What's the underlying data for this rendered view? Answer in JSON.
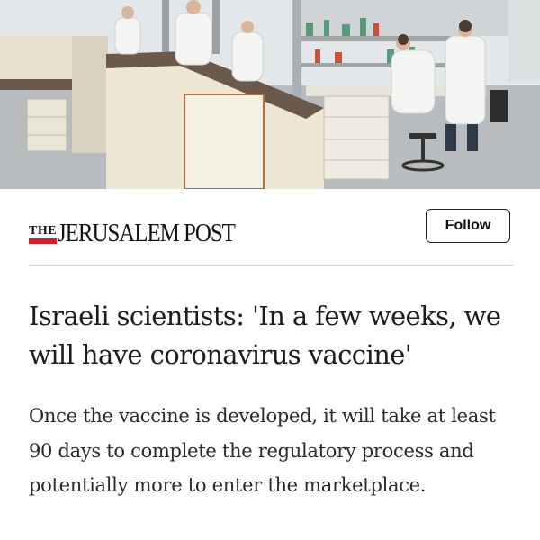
{
  "article_image": {
    "icon": "lab-photo",
    "description_alt": ""
  },
  "source": {
    "logo_the": "THE",
    "logo_name": "JERUSALEM POST",
    "accent_color": "#c8232c",
    "follow_label": "Follow"
  },
  "article": {
    "headline": "Israeli scientists: 'In a few weeks, we will have coronavirus vaccine'",
    "summary": "Once the vaccine is developed, it will take at least 90 days to complete the regulatory process and potentially more to enter the marketplace."
  }
}
